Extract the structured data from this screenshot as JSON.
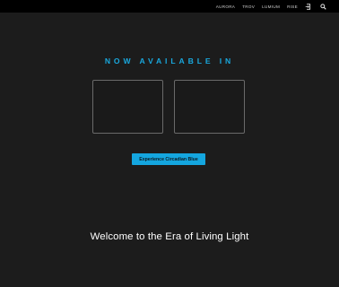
{
  "nav": {
    "links": [
      "AURORA",
      "TROV",
      "LUMIUM",
      "RISE"
    ],
    "icons": [
      "login-icon",
      "search-icon"
    ]
  },
  "main": {
    "headline": "NOW AVAILABLE IN",
    "cta_label": "Experience Circadian Blue",
    "welcome": "Welcome to the Era of Living Light"
  },
  "colors": {
    "accent": "#14a6df",
    "background": "#1c1c1c",
    "topbar": "#000000"
  }
}
